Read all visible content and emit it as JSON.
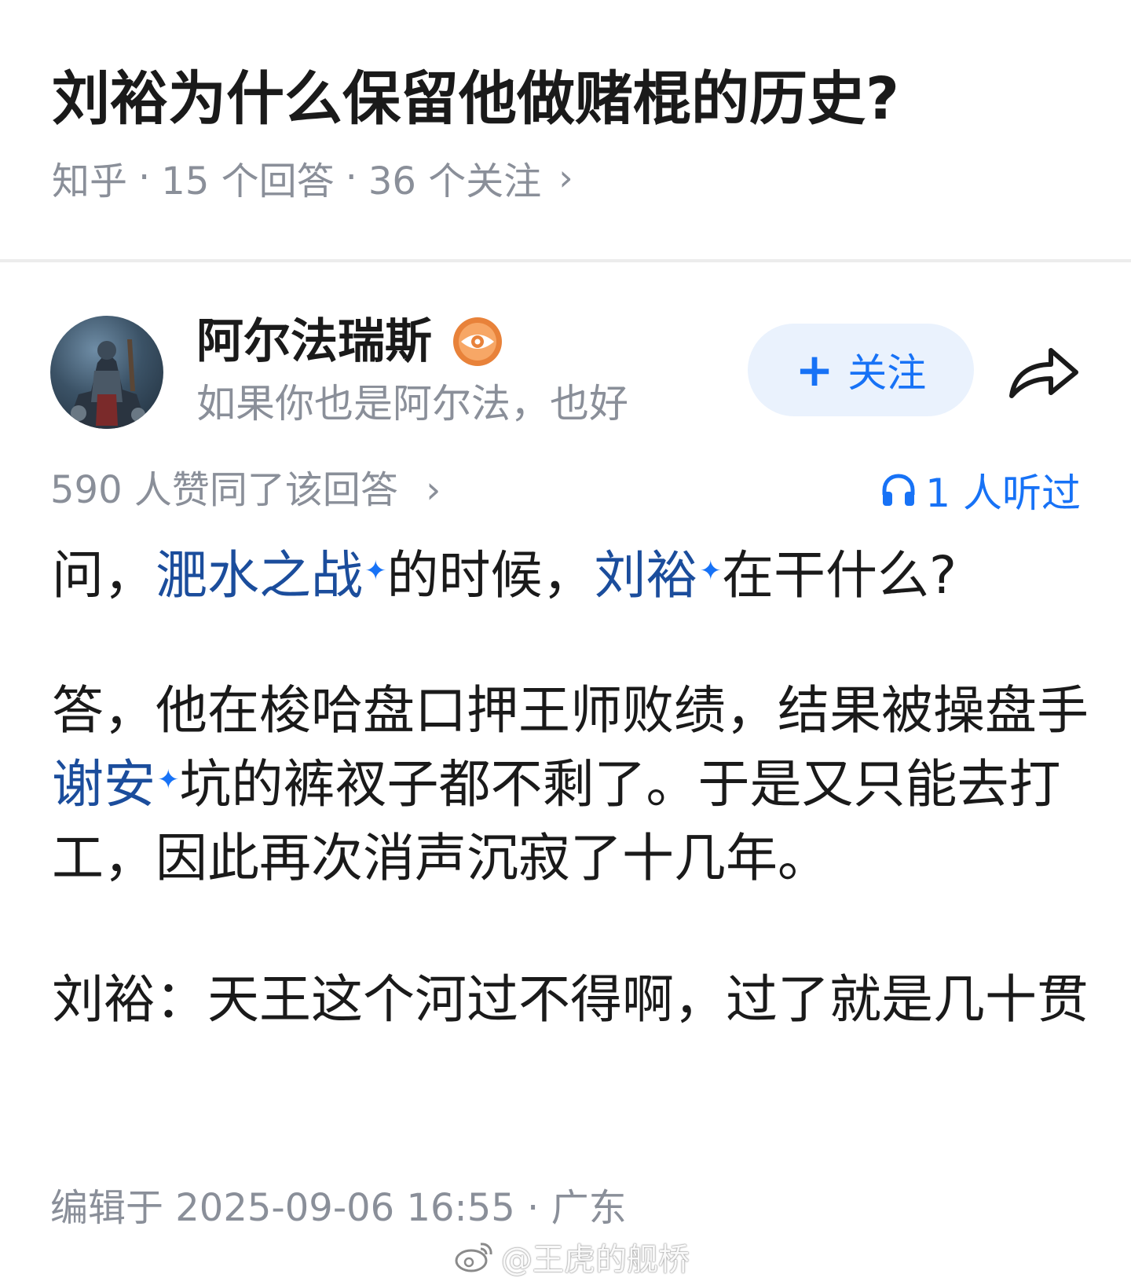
{
  "question": {
    "title": "刘裕为什么保留他做赌棍的历史?",
    "source": "知乎",
    "separator": "·",
    "answers": "15 个回答",
    "followers": "36 个关注",
    "chevron": "›"
  },
  "author": {
    "name": "阿尔法瑞斯",
    "bio": "如果你也是阿尔法，也好",
    "badge_icon": "eye-badge-icon",
    "follow_label": "关注",
    "follow_plus": "+",
    "share_icon": "share-arrow-icon"
  },
  "stats": {
    "votes": "590 人赞同了该回答",
    "chevron": "›",
    "listen": "1 人听过",
    "listen_icon": "headphones-icon"
  },
  "answer": {
    "p1_a": "问，",
    "p1_link1": "淝水之战",
    "p1_b": "的时候，",
    "p1_link2": "刘裕",
    "p1_c": "在干什么?",
    "p2_a": "答，他在梭哈盘口押王师败绩，结果被操盘手",
    "p2_link1": "谢安",
    "p2_b": "坑的裤衩子都不剩了。于是又只能去打工，因此再次消声沉寂了十几年。",
    "p3": "刘裕：天王这个河过不得啊，过了就是几十贯",
    "spark": "✦"
  },
  "footer": {
    "edit": "编辑于 2025-09-06 16:55 · 广东"
  },
  "watermark": {
    "text": "@王虎的舰桥",
    "icon": "weibo-logo-icon"
  },
  "colors": {
    "link": "#1b4d9c",
    "accent": "#1772f6",
    "meta": "#8a8f99",
    "follow_bg": "#eaf2fd",
    "badge": "#e8823a"
  }
}
